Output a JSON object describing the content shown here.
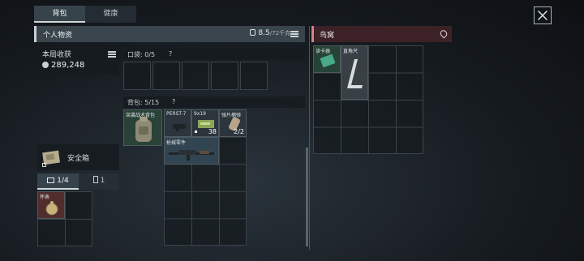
{
  "tabs": [
    {
      "label": "背包"
    },
    {
      "label": "健康"
    }
  ],
  "personal": {
    "title": "个人物资",
    "weight": "8.5",
    "weight_max": "/72千克"
  },
  "earnings": {
    "label": "本局收获",
    "value": "289,248"
  },
  "pocket": {
    "label": "口袋: 0/5",
    "help": "?"
  },
  "backpack": {
    "label": "背包: 5/15",
    "help": "?"
  },
  "items": {
    "backpack_item": "突袭战术背包",
    "perst": "PERST-7",
    "ammo": "9x19",
    "ammo_count": "38",
    "grenade": "弹片榴弹",
    "grenade_count": "2/2",
    "rifle": "枪械零件"
  },
  "safebox": {
    "label": "安全箱"
  },
  "bottom_tabs": [
    {
      "label": "1/4"
    },
    {
      "label": "1"
    }
  ],
  "bottom_item": {
    "label": "怀表"
  },
  "nest": {
    "title": "鸟窝",
    "item1": "读卡器",
    "item2": "直角尺"
  },
  "colors": {
    "accent_red": "#3c2126",
    "header_gray": "#39444c",
    "item_green": "#2f4a3c"
  }
}
